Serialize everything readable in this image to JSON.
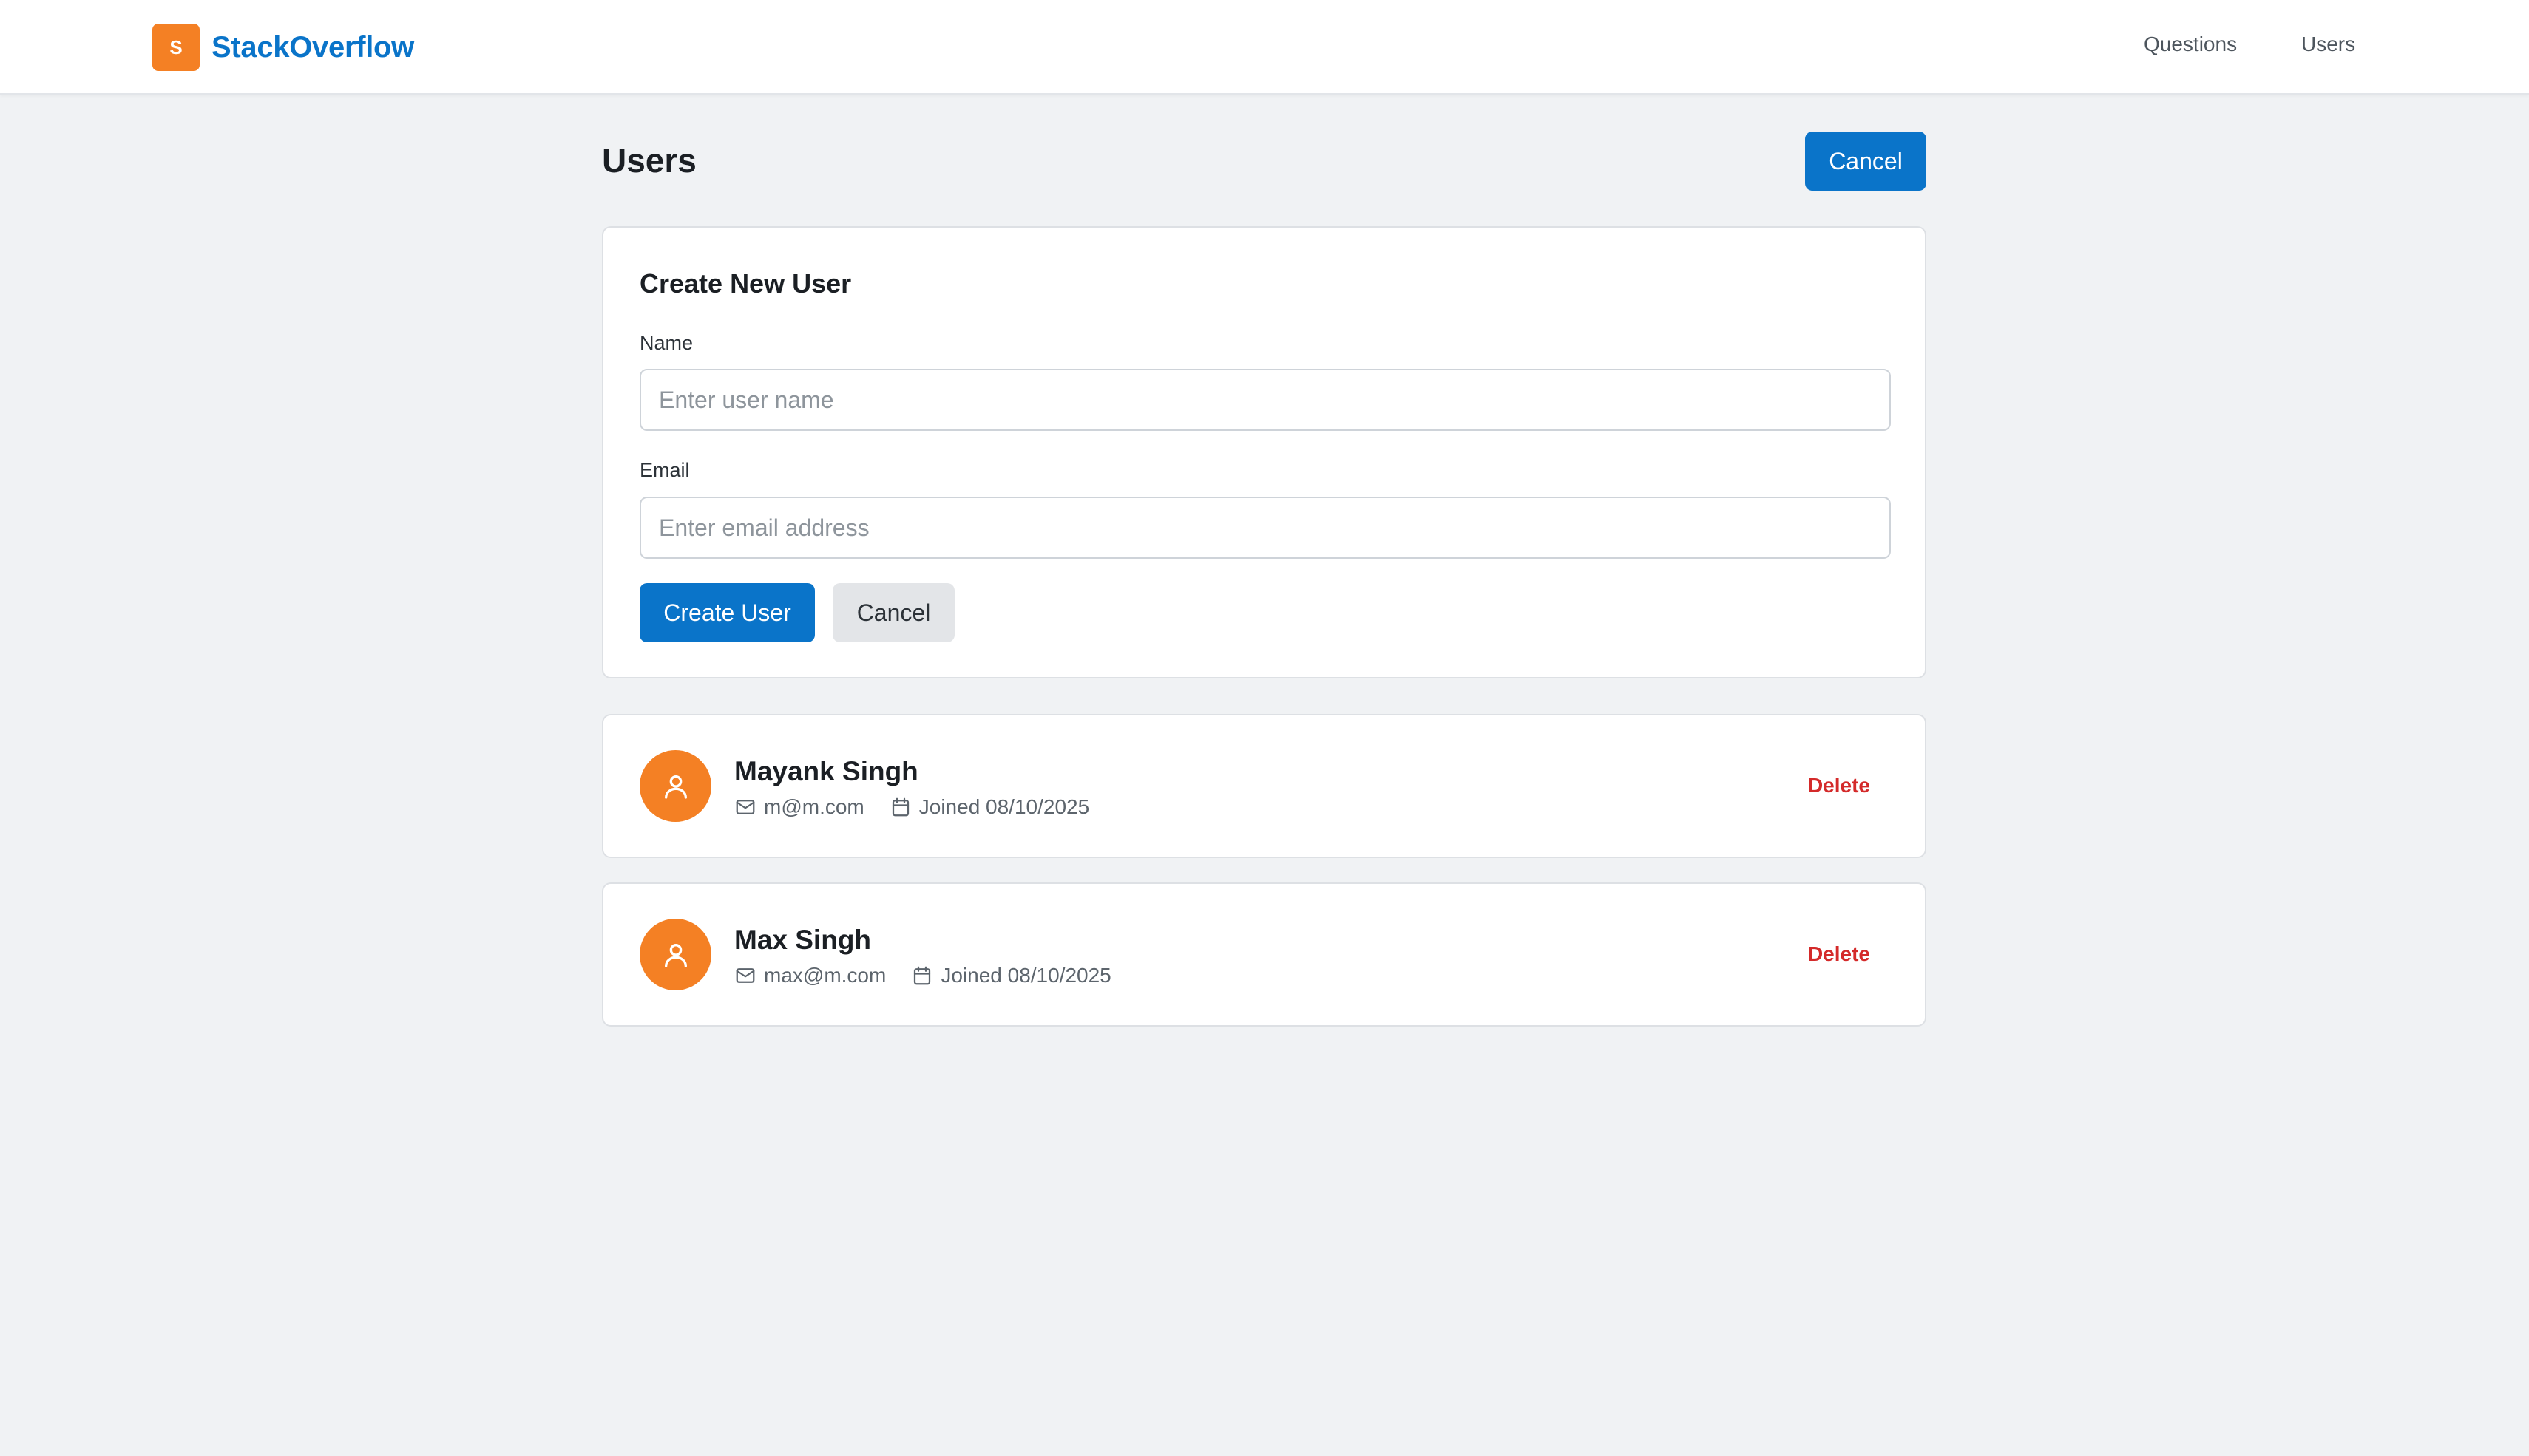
{
  "navbar": {
    "logo_letter": "S",
    "brand_name": "StackOverflow",
    "links": [
      "Questions",
      "Users"
    ]
  },
  "page": {
    "title": "Users",
    "top_cancel_label": "Cancel"
  },
  "form": {
    "title": "Create New User",
    "name_label": "Name",
    "name_placeholder": "Enter user name",
    "name_value": "",
    "email_label": "Email",
    "email_placeholder": "Enter email address",
    "email_value": "",
    "create_label": "Create User",
    "cancel_label": "Cancel"
  },
  "users": [
    {
      "name": "Mayank Singh",
      "email": "m@m.com",
      "joined": "Joined 08/10/2025",
      "delete_label": "Delete"
    },
    {
      "name": "Max Singh",
      "email": "max@m.com",
      "joined": "Joined 08/10/2025",
      "delete_label": "Delete"
    }
  ],
  "colors": {
    "brand_orange": "#f48024",
    "brand_blue": "#0a74c9",
    "danger_red": "#d42a2a",
    "background": "#f0f2f4"
  },
  "icons": {
    "avatar": "user-icon",
    "email": "mail-icon",
    "joined": "calendar-icon"
  }
}
